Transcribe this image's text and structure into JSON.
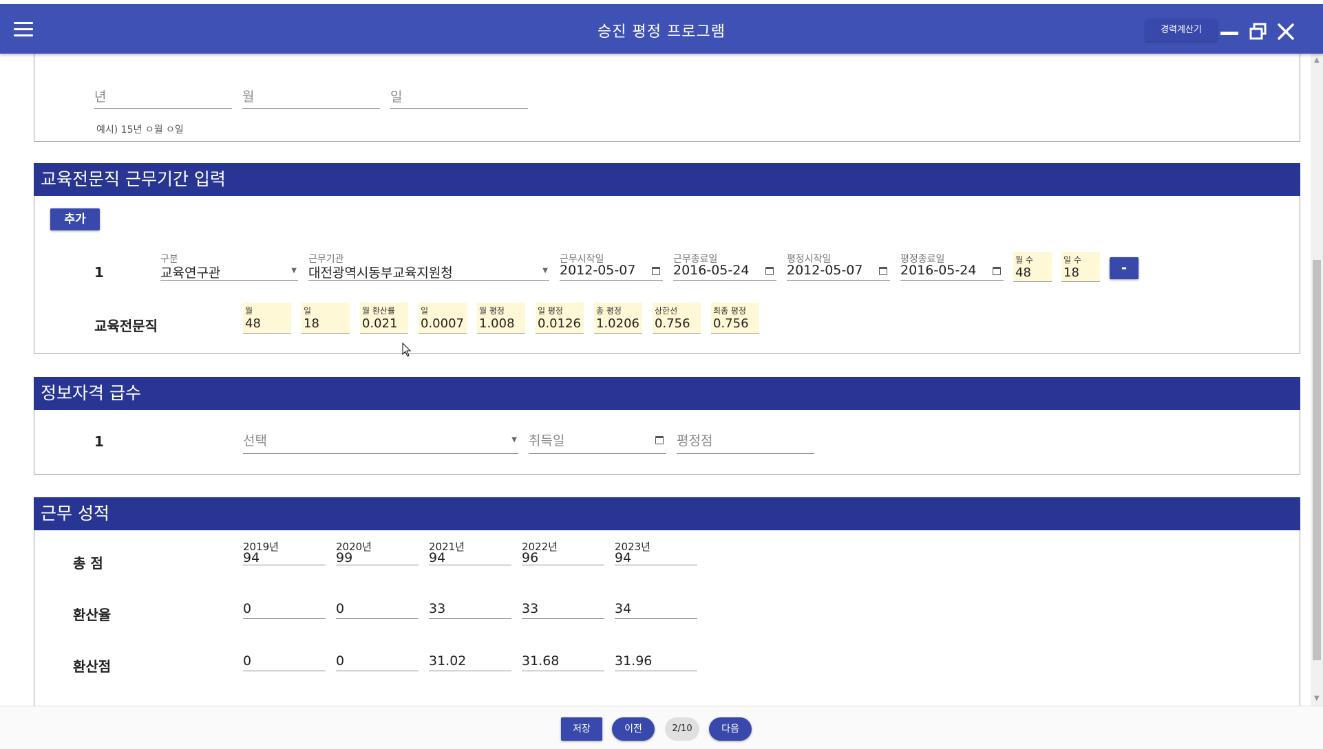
{
  "app": {
    "title": "승진 평정 프로그램",
    "career_calc_label": "경력계산기"
  },
  "top_section": {
    "year_placeholder": "년",
    "month_placeholder": "월",
    "day_placeholder": "일",
    "hint": "예시) 15년 ㅇ월 ㅇ일"
  },
  "edu_section": {
    "title": "교육전문직 근무기간 입력",
    "add_label": "추가",
    "remove_label": "-",
    "row": {
      "index": "1",
      "type_label": "구분",
      "type_value": "교육연구관",
      "org_label": "근무기관",
      "org_value": "대전광역시동부교육지원청",
      "work_start_label": "근무시작일",
      "work_start_value": "2012-05-07",
      "work_end_label": "근무종료일",
      "work_end_value": "2016-05-24",
      "eval_start_label": "평정시작일",
      "eval_start_value": "2012-05-07",
      "eval_end_label": "평정종료일",
      "eval_end_value": "2016-05-24",
      "months_label": "월 수",
      "months_value": "48",
      "days_label": "일 수",
      "days_value": "18"
    },
    "summary": {
      "label": "교육전문직",
      "items": [
        {
          "label": "월",
          "value": "48"
        },
        {
          "label": "일",
          "value": "18"
        },
        {
          "label": "월 환산률",
          "value": "0.021"
        },
        {
          "label": "일",
          "value": "0.0007"
        },
        {
          "label": "월 평정",
          "value": "1.008"
        },
        {
          "label": "일 평정",
          "value": "0.0126"
        },
        {
          "label": "총 평정",
          "value": "1.0206"
        },
        {
          "label": "상한선",
          "value": "0.756"
        },
        {
          "label": "최종 평정",
          "value": "0.756"
        }
      ]
    }
  },
  "info_section": {
    "title": "정보자격 급수",
    "index": "1",
    "select_placeholder": "선택",
    "date_placeholder": "취득일",
    "score_placeholder": "평정점"
  },
  "perf_section": {
    "title": "근무 성적",
    "total_label": "총 점",
    "rate_label": "환산율",
    "conv_label": "환산점",
    "years": [
      "2019년",
      "2020년",
      "2021년",
      "2022년",
      "2023년"
    ],
    "totals": [
      "94",
      "99",
      "94",
      "96",
      "94"
    ],
    "rates": [
      "0",
      "0",
      "33",
      "33",
      "34"
    ],
    "converted": [
      "0",
      "0",
      "31.02",
      "31.68",
      "31.96"
    ]
  },
  "footer": {
    "save_label": "저장",
    "prev_label": "이전",
    "page_indicator": "2/10",
    "next_label": "다음"
  }
}
